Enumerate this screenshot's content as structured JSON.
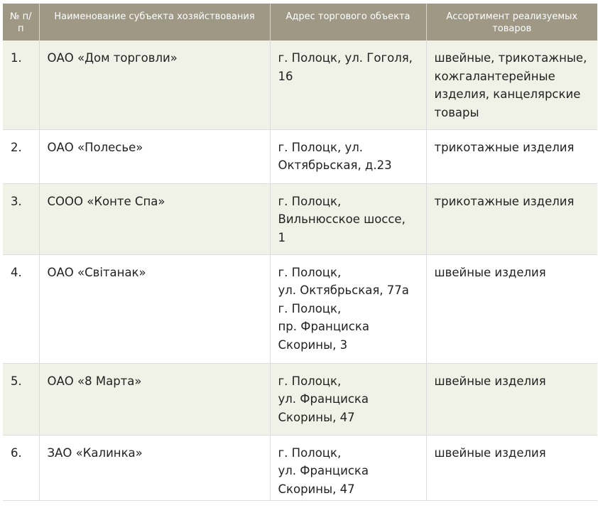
{
  "table": {
    "headers": {
      "num": "№ п/п",
      "name": "Наименование субъекта хозяйствования",
      "address": "Адрес торгового объекта",
      "goods": "Ассортимент реализуемых товаров"
    },
    "rows": [
      {
        "num": "1.",
        "name": "ОАО «Дом торговли»",
        "address": [
          "г. Полоцк, ул. Гоголя,",
          "16"
        ],
        "goods": [
          "швейные, трикотажные,",
          "кожгалантерейные",
          "изделия, канцелярские",
          "товары"
        ]
      },
      {
        "num": "2.",
        "name": "ОАО «Полесье»",
        "address": [
          "г. Полоцк, ул.",
          "Октябрьская, д.23"
        ],
        "goods": [
          "трикотажные изделия"
        ]
      },
      {
        "num": "3.",
        "name": "СООО «Конте Спа»",
        "address": [
          "г. Полоцк,",
          "Вильнюсское шоссе,",
          "1"
        ],
        "goods": [
          "трикотажные изделия"
        ]
      },
      {
        "num": "4.",
        "name": "ОАО «Світанак»",
        "address": [
          "г. Полоцк,",
          "ул. Октябрьская, 77а",
          "г. Полоцк,",
          "пр. Франциска",
          "Скорины, 3"
        ],
        "goods": [
          "швейные изделия"
        ]
      },
      {
        "num": "5.",
        "name": "ОАО «8 Марта»",
        "address": [
          "г. Полоцк,",
          "ул. Франциска",
          "Скорины, 47"
        ],
        "goods": [
          "швейные изделия"
        ]
      },
      {
        "num": "6.",
        "name": "ЗАО «Калинка»",
        "address": [
          "г. Полоцк,",
          "ул. Франциска",
          "Скорины, 47"
        ],
        "goods": [
          "швейные изделия"
        ]
      }
    ]
  }
}
